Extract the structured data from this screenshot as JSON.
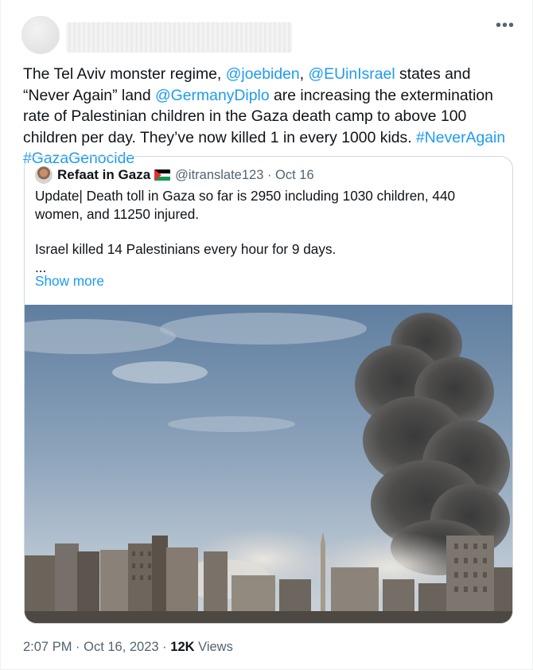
{
  "tweet": {
    "more_label": "•••",
    "body": {
      "p1": "The Tel Aviv monster regime, ",
      "mention1": "@joebiden",
      "p2": ", ",
      "mention2": "@EUinIsrael",
      "p3": "  states and “Never Again” land ",
      "mention3": "@GermanyDiplo",
      "p4": " are increasing the extermination rate of Palestinian children in the Gaza death camp to above 100 children per day. They’ve now killed 1 in every 1000 kids. ",
      "hashtag1": "#NeverAgain",
      "sep": " ",
      "hashtag2": "#GazaGenocide"
    },
    "quote": {
      "name": "Refaat in Gaza",
      "handle": "@itranslate123 · Oct 16",
      "line1": "Update| Death toll in Gaza so far is 2950 including 1030 children, 440 women, and 11250 injured.",
      "line2": "Israel killed 14 Palestinians every hour for 9 days.",
      "line3": "...",
      "show_more": "Show more"
    },
    "meta": {
      "timestamp": "2:07 PM · Oct 16, 2023 · ",
      "views_count": "12K",
      "views_label": " Views"
    }
  },
  "colors": {
    "link": "#1d9bf0",
    "text": "#0f1419",
    "secondary": "#536471",
    "border": "#cfd9de"
  },
  "icons": [
    "more-options-icon",
    "palestine-flag-icon"
  ]
}
